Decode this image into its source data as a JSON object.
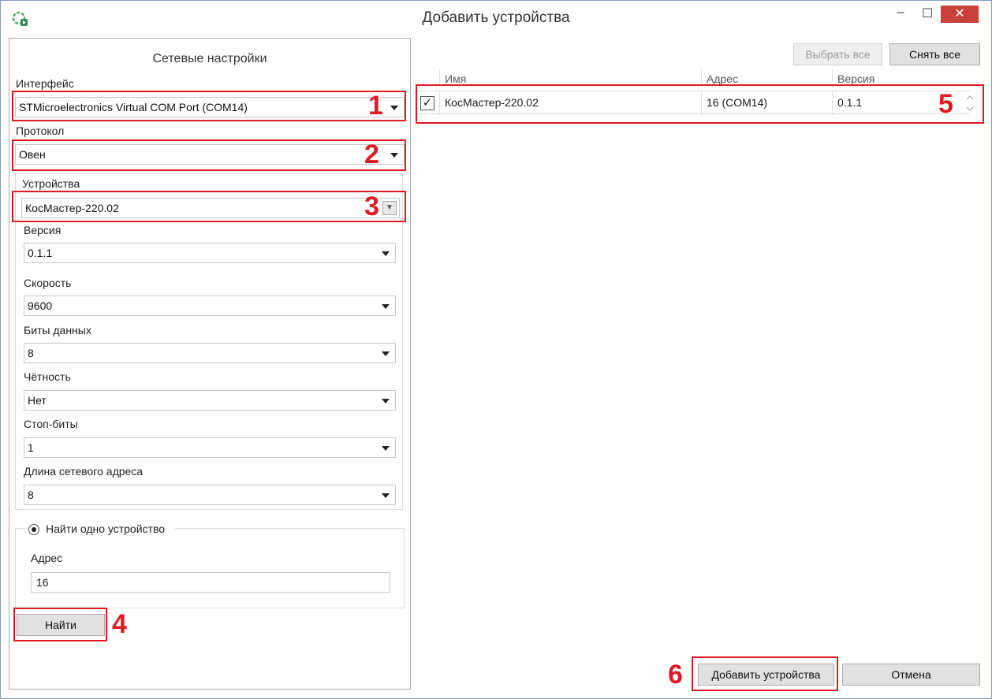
{
  "window": {
    "title": "Добавить устройства",
    "controls": {
      "minimize": "–",
      "maximize": "☐",
      "close": "✕"
    }
  },
  "network_settings": {
    "title": "Сетевые настройки",
    "interface_label": "Интерфейс",
    "interface_value": "STMicroelectronics Virtual COM Port (COM14)",
    "protocol_label": "Протокол",
    "protocol_value": "Овен",
    "devices_label": "Устройства",
    "devices_value": "КосМастер-220.02",
    "version_label": "Версия",
    "version_value": "0.1.1",
    "speed_label": "Скорость",
    "speed_value": "9600",
    "databits_label": "Биты данных",
    "databits_value": "8",
    "parity_label": "Чётность",
    "parity_value": "Нет",
    "stopbits_label": "Стоп-биты",
    "stopbits_value": "1",
    "addrlen_label": "Длина сетевого адреса",
    "addrlen_value": "8"
  },
  "search": {
    "single_device_label": "Найти одно устройство",
    "address_label": "Адрес",
    "address_value": "16",
    "find_button": "Найти"
  },
  "device_list": {
    "select_all_button": "Выбрать все",
    "deselect_all_button": "Снять все",
    "columns": [
      "Имя",
      "Адрес",
      "Версия"
    ],
    "rows": [
      {
        "checked": true,
        "name": "КосМастер-220.02",
        "address": "16 (COM14)",
        "version": "0.1.1"
      }
    ]
  },
  "footer": {
    "add_button": "Добавить устройства",
    "cancel_button": "Отмена"
  },
  "annotations": [
    "1",
    "2",
    "3",
    "4",
    "5",
    "6"
  ],
  "colors": {
    "annotation": "#e01a22",
    "close_button": "#c8423b",
    "accent": "#2e8b57"
  }
}
